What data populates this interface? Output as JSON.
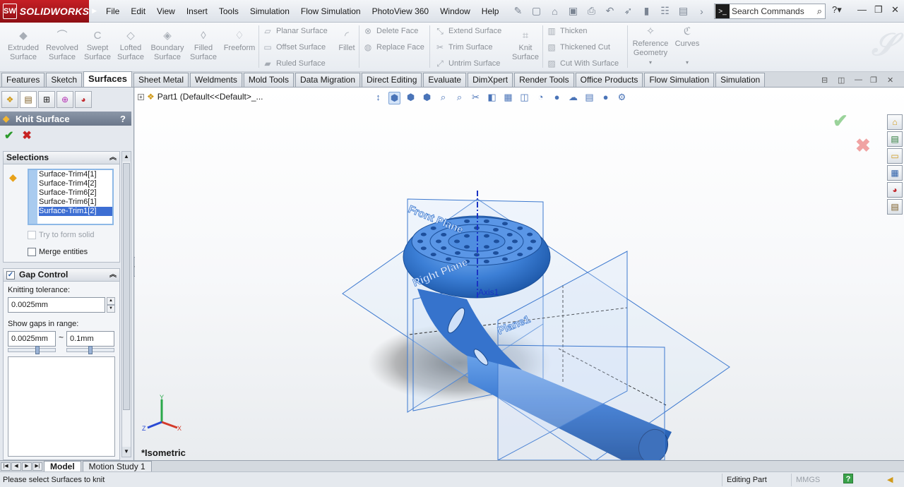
{
  "app": {
    "brand": "SOLIDWORKS",
    "badge": "SW"
  },
  "menu": [
    "File",
    "Edit",
    "View",
    "Insert",
    "Tools",
    "Simulation",
    "Flow Simulation",
    "PhotoView 360",
    "Window",
    "Help"
  ],
  "search": {
    "placeholder": "Search Commands"
  },
  "ribbon": {
    "large": {
      "extruded": "Extruded\nSurface",
      "revolved": "Revolved\nSurface",
      "swept": "Swept\nSurface",
      "lofted": "Lofted\nSurface",
      "boundary": "Boundary\nSurface",
      "filled": "Filled\nSurface",
      "freeform": "Freeform",
      "fillet": "Fillet",
      "knit": "Knit\nSurface",
      "refgeom": "Reference\nGeometry",
      "curves": "Curves"
    },
    "small": {
      "planar": "Planar Surface",
      "offset": "Offset Surface",
      "ruled": "Ruled Surface",
      "delete_face": "Delete Face",
      "replace_face": "Replace Face",
      "extend": "Extend Surface",
      "trim": "Trim Surface",
      "untrim": "Untrim Surface",
      "thicken": "Thicken",
      "thickened_cut": "Thickened Cut",
      "cut_with_surface": "Cut With Surface"
    }
  },
  "tabs": [
    "Features",
    "Sketch",
    "Surfaces",
    "Sheet Metal",
    "Weldments",
    "Mold Tools",
    "Data Migration",
    "Direct Editing",
    "Evaluate",
    "DimXpert",
    "Render Tools",
    "Office Products",
    "Flow Simulation",
    "Simulation"
  ],
  "active_tab": "Surfaces",
  "property_manager": {
    "title": "Knit Surface",
    "help": "?",
    "selections": {
      "header": "Selections",
      "items": [
        "Surface-Trim4[1]",
        "Surface-Trim4[2]",
        "Surface-Trim6[2]",
        "Surface-Trim6[1]",
        "Surface-Trim1[2]"
      ],
      "selected_index": 4,
      "try_form_solid": "Try to form solid",
      "merge_entities": "Merge entities"
    },
    "gap_control": {
      "header": "Gap Control",
      "tolerance_label": "Knitting tolerance:",
      "tolerance_value": "0.0025mm",
      "range_label": "Show gaps in range:",
      "range_min": "0.0025mm",
      "range_sep": "~",
      "range_max": "0.1mm"
    }
  },
  "graphics": {
    "tree_label": "Part1  (Default<<Default>_...",
    "view_name": "*Isometric",
    "labels": {
      "front_plane": "Front Plane",
      "right_plane": "Right Plane",
      "plane1": "Plane1",
      "axis": "Axis1",
      "triad_x": "X",
      "triad_y": "Y",
      "triad_z": "Z"
    },
    "model_color": "#3c7fd6"
  },
  "bottom_tabs": [
    "Model",
    "Motion Study 1"
  ],
  "status": {
    "message": "Please select Surfaces to knit",
    "mode": "Editing Part",
    "units": "MMGS",
    "help": "?"
  }
}
